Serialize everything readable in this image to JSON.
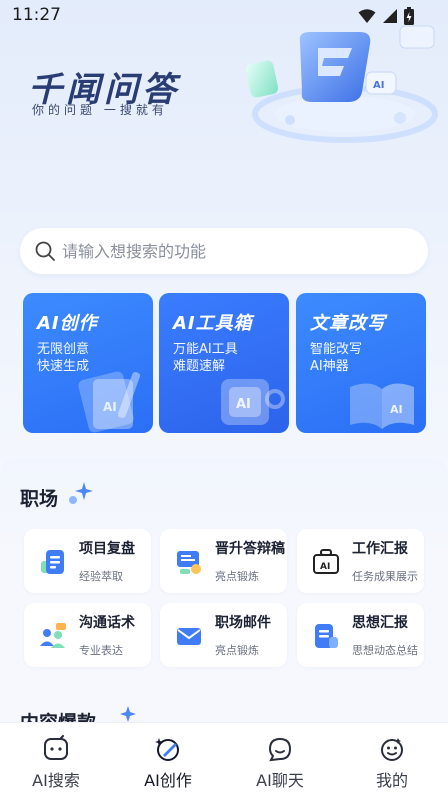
{
  "status_bar": {
    "time": "11:27"
  },
  "brand": {
    "title": "千闻问答",
    "subtitle": "你的问题 一搜就有"
  },
  "search": {
    "placeholder": "请输入想搜索的功能"
  },
  "feature_cards": [
    {
      "title": "AI创作",
      "desc1": "无限创意",
      "desc2": "快速生成",
      "color": "#2f7bff"
    },
    {
      "title": "AI工具箱",
      "desc1": "万能AI工具",
      "desc2": "难题速解",
      "color": "#2f6cf0"
    },
    {
      "title": "文章改写",
      "desc1": "智能改写",
      "desc2": "AI神器",
      "color": "#2f7bff"
    }
  ],
  "sections": {
    "workplace": {
      "title": "职场",
      "items": [
        {
          "name": "项目复盘",
          "sub": "经验萃取",
          "icon": "document-icon"
        },
        {
          "name": "晋升答辩稿",
          "sub": "亮点锻炼",
          "icon": "presentation-icon"
        },
        {
          "name": "工作汇报",
          "sub": "任务成果展示",
          "icon": "briefcase-ai-icon"
        },
        {
          "name": "沟通话术",
          "sub": "专业表达",
          "icon": "people-chat-icon"
        },
        {
          "name": "职场邮件",
          "sub": "亮点锻炼",
          "icon": "mail-icon"
        },
        {
          "name": "思想汇报",
          "sub": "思想动态总结",
          "icon": "report-icon"
        }
      ]
    },
    "content": {
      "title": "内容爆款"
    }
  },
  "nav": [
    {
      "label": "AI搜索",
      "icon": "ai-search-icon"
    },
    {
      "label": "AI创作",
      "icon": "ai-create-icon"
    },
    {
      "label": "AI聊天",
      "icon": "ai-chat-icon"
    },
    {
      "label": "我的",
      "icon": "profile-icon"
    }
  ],
  "colors": {
    "accent": "#2f7bff",
    "accent_light": "#7fb0ff"
  }
}
